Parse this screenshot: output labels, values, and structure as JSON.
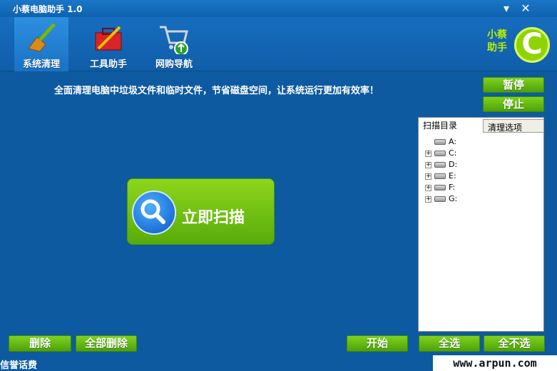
{
  "window": {
    "title": "小蔡电脑助手 1.0",
    "minimize_glyph": "▾",
    "close_glyph": "✕"
  },
  "tabs": [
    {
      "label": "系统清理",
      "icon": "broom-icon",
      "active": true
    },
    {
      "label": "工具助手",
      "icon": "toolbox-icon",
      "active": false
    },
    {
      "label": "网购导航",
      "icon": "shopping-cart-icon",
      "active": false
    }
  ],
  "logo": {
    "line1": "小蔡",
    "line2": "助手",
    "letter": "C"
  },
  "tagline": "全面清理电脑中垃圾文件和临时文件，节省磁盘空间，让系统运行更加有效率！",
  "controls": {
    "pause": "暂停",
    "stop": "停止"
  },
  "scan": {
    "label": "立即扫描"
  },
  "panel": {
    "tab_active": "扫描目录",
    "tab_inactive": "清理选项",
    "drives": [
      "A:",
      "C:",
      "D:",
      "E:",
      "F:",
      "G:"
    ]
  },
  "bottom": {
    "delete": "删除",
    "delete_all": "全部删除",
    "start": "开始",
    "select_all": "全选",
    "select_none": "全不选"
  },
  "status": {
    "text": "信誉话费",
    "watermark": "www.arpun.com"
  },
  "colors": {
    "accent_green": "#6cc416",
    "background": "#0d5aa0"
  }
}
